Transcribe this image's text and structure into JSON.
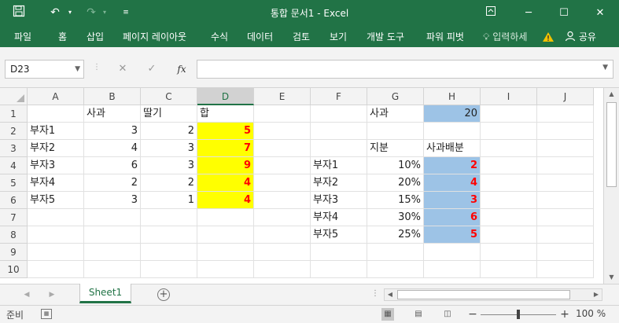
{
  "titlebar": {
    "title": "통합 문서1 - Excel",
    "icons": [
      "save-icon",
      "undo-icon",
      "redo-icon",
      "customize-icon",
      "ribbon-display-icon",
      "minimize-icon",
      "maximize-icon",
      "close-icon"
    ]
  },
  "ribbon": {
    "tabs": [
      "파일",
      "홈",
      "삽입",
      "페이지 레이아웃",
      "수식",
      "데이터",
      "검토",
      "보기",
      "개발 도구",
      "파워 피벗"
    ],
    "tell_me": "입력하세",
    "share": "공유"
  },
  "formula_bar": {
    "name_box": "D23",
    "fx_label": "fx",
    "formula": ""
  },
  "columns": [
    "A",
    "B",
    "C",
    "D",
    "E",
    "F",
    "G",
    "H",
    "I",
    "J"
  ],
  "selected_column": "D",
  "rows": [
    "1",
    "2",
    "3",
    "4",
    "5",
    "6",
    "7",
    "8",
    "9",
    "10"
  ],
  "cells": {
    "B1": "사과",
    "C1": "딸기",
    "D1": "합",
    "A2": "부자1",
    "B2": "3",
    "C2": "2",
    "D2": "5",
    "A3": "부자2",
    "B3": "4",
    "C3": "3",
    "D3": "7",
    "A4": "부자3",
    "B4": "6",
    "C4": "3",
    "D4": "9",
    "A5": "부자4",
    "B5": "2",
    "C5": "2",
    "D5": "4",
    "A6": "부자5",
    "B6": "3",
    "C6": "1",
    "D6": "4",
    "G1": "사과",
    "H1": "20",
    "G3": "지분",
    "H3": "사과배분",
    "F4": "부자1",
    "G4": "10%",
    "H4": "2",
    "F5": "부자2",
    "G5": "20%",
    "H5": "4",
    "F6": "부자3",
    "G6": "15%",
    "H6": "3",
    "F7": "부자4",
    "G7": "30%",
    "H7": "6",
    "F8": "부자5",
    "G8": "25%",
    "H8": "5"
  },
  "fill_colors": {
    "yellow": "#ffff00",
    "blue": "#9dc3e6",
    "red_text": "#ff0000",
    "accent": "#217346"
  },
  "sheets": [
    "Sheet1"
  ],
  "active_sheet": "Sheet1",
  "status": {
    "mode": "준비",
    "zoom": "100 %",
    "zoom_percent": 100
  }
}
